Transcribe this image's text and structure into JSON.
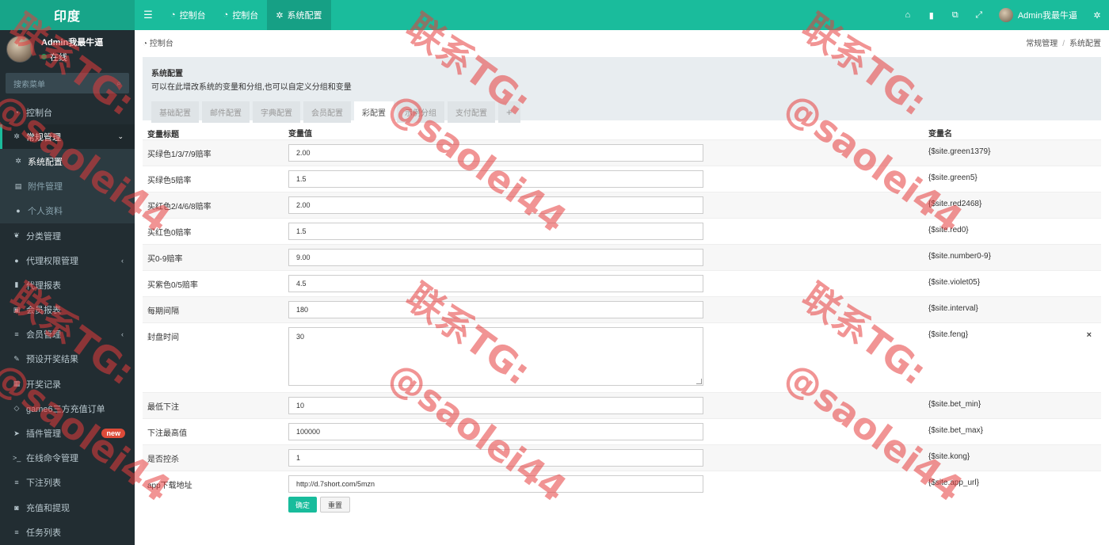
{
  "app": {
    "logo": "印度"
  },
  "topbar": {
    "tabs": [
      {
        "label": "控制台",
        "active": false
      },
      {
        "label": "控制台",
        "active": false
      },
      {
        "label": "系统配置",
        "active": true
      }
    ],
    "user": "Admin我最牛逼"
  },
  "sidebar": {
    "user": {
      "name": "Admin我最牛逼",
      "status": "在线"
    },
    "search_placeholder": "搜索菜单",
    "items": [
      {
        "label": "控制台",
        "icon": "dashboard-icon",
        "type": "top"
      },
      {
        "label": "常规管理",
        "icon": "cogs-icon",
        "type": "open"
      },
      {
        "label": "系统配置",
        "icon": "gear-icon",
        "type": "sub-active"
      },
      {
        "label": "附件管理",
        "icon": "file-image-icon",
        "type": "sub"
      },
      {
        "label": "个人资料",
        "icon": "user-icon",
        "type": "sub"
      },
      {
        "label": "分类管理",
        "icon": "leaf-icon",
        "type": "top"
      },
      {
        "label": "代理权限管理",
        "icon": "group-icon",
        "type": "top-caret"
      },
      {
        "label": "代理报表",
        "icon": "book-icon",
        "type": "top"
      },
      {
        "label": "会员报表",
        "icon": "address-book-icon",
        "type": "top"
      },
      {
        "label": "会员管理",
        "icon": "list-icon",
        "type": "top-caret"
      },
      {
        "label": "预设开奖结果",
        "icon": "edit-icon",
        "type": "top"
      },
      {
        "label": "开奖记录",
        "icon": "calendar-icon",
        "type": "top"
      },
      {
        "label": "game6三方充值订单",
        "icon": "diamond-icon",
        "type": "top"
      },
      {
        "label": "插件管理",
        "icon": "rocket-icon",
        "type": "top-new"
      },
      {
        "label": "在线命令管理",
        "icon": "terminal-icon",
        "type": "top"
      },
      {
        "label": "下注列表",
        "icon": "list-icon",
        "type": "top"
      },
      {
        "label": "充值和提现",
        "icon": "money-icon",
        "type": "top"
      },
      {
        "label": "任务列表",
        "icon": "tasks-icon",
        "type": "top"
      }
    ],
    "new_badge": "new"
  },
  "breadcrumb": {
    "left": "控制台",
    "right": [
      "常规管理",
      "系统配置"
    ]
  },
  "panel": {
    "title": "系统配置",
    "desc": "可以在此增改系统的变量和分组,也可以自定义分组和变量",
    "tabs": [
      {
        "label": "基础配置",
        "active": false
      },
      {
        "label": "邮件配置",
        "active": false
      },
      {
        "label": "字典配置",
        "active": false
      },
      {
        "label": "会员配置",
        "active": false
      },
      {
        "label": "彩配置",
        "active": true
      },
      {
        "label": "示例分组",
        "active": false
      },
      {
        "label": "支付配置",
        "active": false
      },
      {
        "label": "+",
        "active": false
      }
    ]
  },
  "table": {
    "headers": [
      "变量标题",
      "变量值",
      "变量名"
    ],
    "rows": [
      {
        "title": "买绿色1/3/7/9赔率",
        "value": "2.00",
        "name": "{$site.green1379}",
        "type": "input"
      },
      {
        "title": "买绿色5赔率",
        "value": "1.5",
        "name": "{$site.green5}",
        "type": "input"
      },
      {
        "title": "买红色2/4/6/8赔率",
        "value": "2.00",
        "name": "{$site.red2468}",
        "type": "input"
      },
      {
        "title": "买红色0赔率",
        "value": "1.5",
        "name": "{$site.red0}",
        "type": "input"
      },
      {
        "title": "买0-9赔率",
        "value": "9.00",
        "name": "{$site.number0-9}",
        "type": "input"
      },
      {
        "title": "买紫色0/5赔率",
        "value": "4.5",
        "name": "{$site.violet05}",
        "type": "input"
      },
      {
        "title": "每期间隔",
        "value": "180",
        "name": "{$site.interval}",
        "type": "input"
      },
      {
        "title": "封盘时间",
        "value": "30",
        "name": "{$site.feng}",
        "type": "textarea"
      },
      {
        "title": "最低下注",
        "value": "10",
        "name": "{$site.bet_min}",
        "type": "input"
      },
      {
        "title": "下注最高值",
        "value": "100000",
        "name": "{$site.bet_max}",
        "type": "input"
      },
      {
        "title": "是否控杀",
        "value": "1",
        "name": "{$site.kong}",
        "type": "input"
      },
      {
        "title": "app下载地址",
        "value": "http://d.7short.com/5mzn",
        "name": "{$site.app_url}",
        "type": "input"
      }
    ],
    "delete_glyph": "×"
  },
  "buttons": {
    "ok": "确定",
    "reset": "重置"
  },
  "watermark": {
    "line1": "联系TG:",
    "line2": "@saolei44"
  }
}
